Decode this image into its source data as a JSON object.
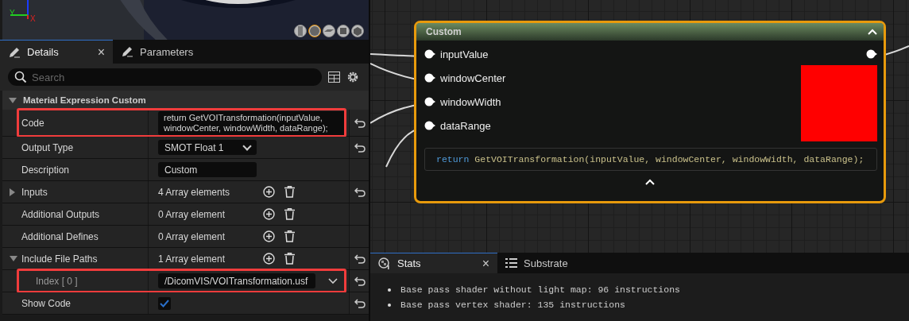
{
  "viewport": {
    "axis_labels": [
      "Y",
      "X"
    ],
    "preview_buttons": [
      {
        "kind": "cylinder",
        "selected": false
      },
      {
        "kind": "sphere",
        "selected": true
      },
      {
        "kind": "plane",
        "selected": false
      },
      {
        "kind": "cube",
        "selected": false
      },
      {
        "kind": "custom",
        "selected": false
      }
    ]
  },
  "details_tabs": [
    {
      "label": "Details",
      "selected": true,
      "close": "×"
    },
    {
      "label": "Parameters",
      "selected": false
    }
  ],
  "search": {
    "placeholder": "Search"
  },
  "section": {
    "title": "Material Expression Custom",
    "expanded": true
  },
  "properties": [
    {
      "label": "Code",
      "kind": "textarea",
      "value": "return GetVOITransformation(inputValue, windowCenter, windowWidth, dataRange);",
      "reset": true,
      "highlighted": true
    },
    {
      "label": "Output Type",
      "kind": "dropdown",
      "value": "SMOT Float 1",
      "reset": true,
      "highlighted": false
    },
    {
      "label": "Description",
      "kind": "text",
      "value": "Custom",
      "reset": false,
      "highlighted": false
    },
    {
      "label": "Inputs",
      "kind": "array",
      "value": "4 Array elements",
      "expanded": false,
      "reset": true,
      "highlighted": false
    },
    {
      "label": "Additional Outputs",
      "kind": "array",
      "value": "0 Array element",
      "reset": false,
      "highlighted": false
    },
    {
      "label": "Additional Defines",
      "kind": "array",
      "value": "0 Array element",
      "reset": false,
      "highlighted": false
    },
    {
      "label": "Include File Paths",
      "kind": "array",
      "value": "1 Array element",
      "expanded": true,
      "reset": true,
      "highlighted": false,
      "children": [
        {
          "label": "Index [ 0 ]",
          "kind": "combo",
          "value": "/DicomVIS/VOITransformation.usf",
          "reset": true,
          "highlighted": true
        }
      ]
    },
    {
      "label": "Show Code",
      "kind": "checkbox",
      "checked": true,
      "reset": true,
      "highlighted": false
    }
  ],
  "node": {
    "title": "Custom",
    "selected": true,
    "inputs": [
      "inputValue",
      "windowCenter",
      "windowWidth",
      "dataRange"
    ],
    "code_keyword": "return",
    "code_text": "GetVOITransformation(inputValue, windowCenter, windowWidth, dataRange);"
  },
  "stats_tabs": [
    {
      "label": "Stats",
      "selected": true,
      "close": "×"
    },
    {
      "label": "Substrate",
      "selected": false
    }
  ],
  "stats": [
    "Base pass shader without light map: 96 instructions",
    "Base pass vertex shader: 135 instructions"
  ]
}
